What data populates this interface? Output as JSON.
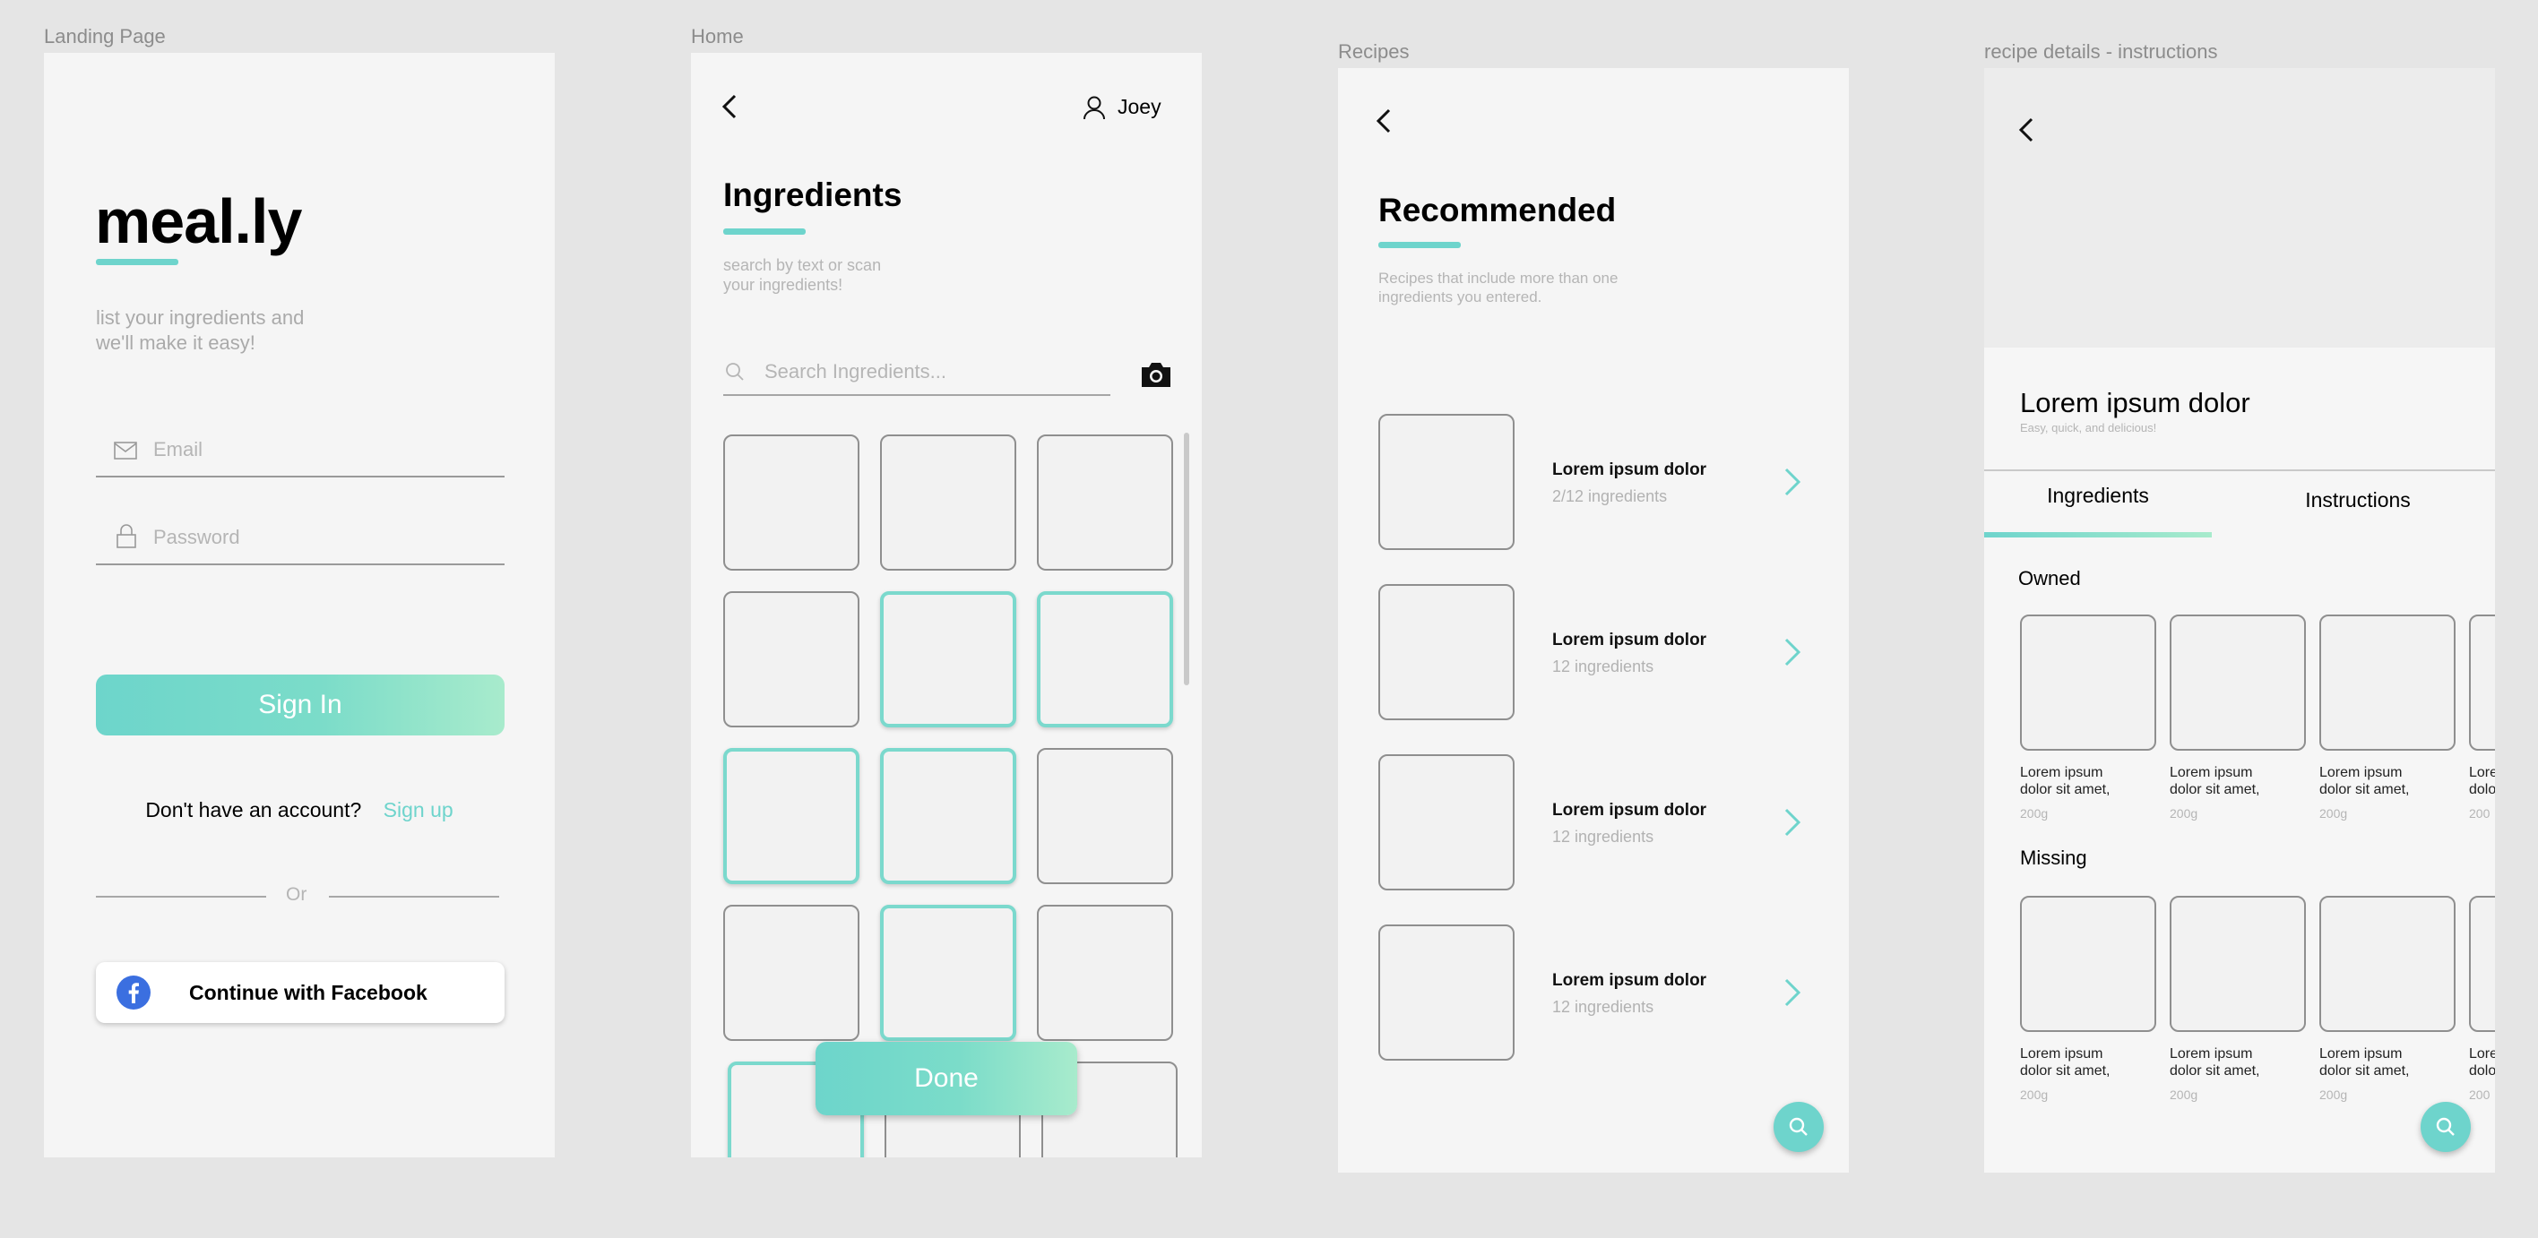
{
  "frames": {
    "landing": {
      "label": "Landing Page",
      "logo": "meal.ly",
      "tagline_line1": "list your ingredients and",
      "tagline_line2": "we'll make it easy!",
      "email_placeholder": "Email",
      "password_placeholder": "Password",
      "sign_in": "Sign In",
      "no_account": "Don't have an account?",
      "sign_up": "Sign up",
      "or": "Or",
      "facebook": "Continue with Facebook"
    },
    "home": {
      "label": "Home",
      "user": "Joey",
      "title": "Ingredients",
      "subtitle_line1": "search by text or scan",
      "subtitle_line2": "your ingredients!",
      "search_placeholder": "Search Ingredients...",
      "done": "Done"
    },
    "recipes": {
      "label": "Recipes",
      "title": "Recommended",
      "subtitle_line1": "Recipes that include more than one",
      "subtitle_line2": "ingredients you entered.",
      "items": [
        {
          "title": "Lorem ipsum dolor",
          "sub": "2/12 ingredients"
        },
        {
          "title": "Lorem ipsum dolor",
          "sub": "12 ingredients"
        },
        {
          "title": "Lorem ipsum dolor",
          "sub": "12 ingredients"
        },
        {
          "title": "Lorem ipsum dolor",
          "sub": "12 ingredients"
        }
      ]
    },
    "details": {
      "label": "recipe details - instructions",
      "title": "Lorem ipsum dolor",
      "subtitle": "Easy, quick, and delicious!",
      "tab_ingredients": "Ingredients",
      "tab_instructions": "Instructions",
      "owned": "Owned",
      "missing": "Missing",
      "owned_items": [
        {
          "line1": "Lorem ipsum",
          "line2": "dolor sit amet,",
          "weight": "200g"
        },
        {
          "line1": "Lorem ipsum",
          "line2": "dolor sit amet,",
          "weight": "200g"
        },
        {
          "line1": "Lorem ipsum",
          "line2": "dolor sit amet,",
          "weight": "200g"
        },
        {
          "line1": "Lorem",
          "line2": "dolo",
          "weight": "200"
        }
      ],
      "missing_items": [
        {
          "line1": "Lorem ipsum",
          "line2": "dolor sit amet,",
          "weight": "200g"
        },
        {
          "line1": "Lorem ipsum",
          "line2": "dolor sit amet,",
          "weight": "200g"
        },
        {
          "line1": "Lorem ipsum",
          "line2": "dolor sit amet,",
          "weight": "200g"
        },
        {
          "line1": "Lorem",
          "line2": "dolo",
          "weight": "200"
        }
      ]
    }
  },
  "colors": {
    "accent": "#6ed4cc",
    "canvas": "#e5e5e5",
    "frame": "#f5f5f5",
    "facebook": "#3b6fe0"
  },
  "icons": [
    "mail-icon",
    "lock-icon",
    "facebook-icon",
    "back-chevron-icon",
    "user-icon",
    "search-icon",
    "camera-icon",
    "chevron-right-icon"
  ]
}
